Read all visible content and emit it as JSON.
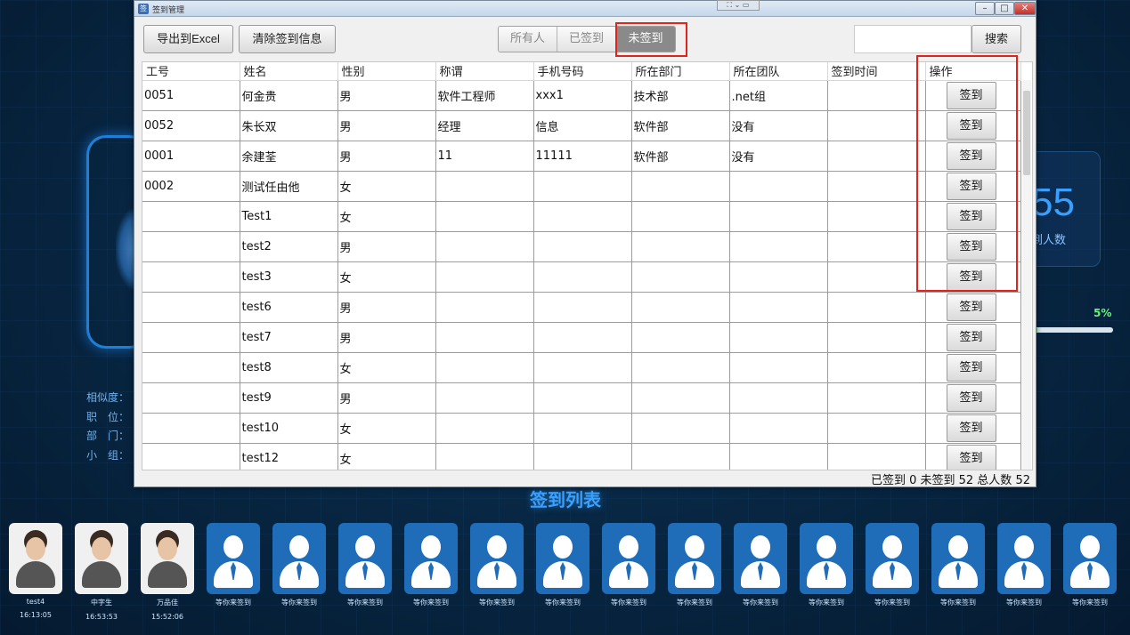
{
  "window": {
    "title": "签到管理",
    "float_bar": "⛶ ⌄ ▭"
  },
  "toolbar": {
    "export_label": "导出到Excel",
    "clear_label": "清除签到信息",
    "filters": [
      "所有人",
      "已签到",
      "未签到"
    ],
    "active_filter": "未签到",
    "search_value": "",
    "search_label": "搜索"
  },
  "table": {
    "columns": [
      "工号",
      "姓名",
      "性别",
      "称谓",
      "手机号码",
      "所在部门",
      "所在团队",
      "签到时间",
      "操作"
    ],
    "action_label": "签到",
    "rows": [
      [
        "0051",
        "何金贵",
        "男",
        "软件工程师",
        "xxx1",
        "技术部",
        ".net组",
        ""
      ],
      [
        "0052",
        "朱长双",
        "男",
        "经理",
        "信息",
        "软件部",
        "没有",
        ""
      ],
      [
        "0001",
        "余建荃",
        "男",
        "11",
        "11111",
        "软件部",
        "没有",
        ""
      ],
      [
        "0002",
        "测试任由他",
        "女",
        "",
        "",
        "",
        "",
        ""
      ],
      [
        "",
        "Test1",
        "女",
        "",
        "",
        "",
        "",
        ""
      ],
      [
        "",
        "test2",
        "男",
        "",
        "",
        "",
        "",
        ""
      ],
      [
        "",
        "test3",
        "女",
        "",
        "",
        "",
        "",
        ""
      ],
      [
        "",
        "test6",
        "男",
        "",
        "",
        "",
        "",
        ""
      ],
      [
        "",
        "test7",
        "男",
        "",
        "",
        "",
        "",
        ""
      ],
      [
        "",
        "test8",
        "女",
        "",
        "",
        "",
        "",
        ""
      ],
      [
        "",
        "test9",
        "男",
        "",
        "",
        "",
        "",
        ""
      ],
      [
        "",
        "test10",
        "女",
        "",
        "",
        "",
        "",
        ""
      ],
      [
        "",
        "test12",
        "女",
        "",
        "",
        "",
        "",
        ""
      ]
    ]
  },
  "status_bar": "已签到  0    未签到   52 总人数   52",
  "dashboard": {
    "info_labels": [
      "相似度：",
      "职　位：",
      "部　门：",
      "小　组："
    ],
    "stat_number": "55",
    "stat_label": "到人数",
    "percent": "5%",
    "percent_value": 0.05,
    "list_title": "签到列表"
  },
  "avatars": [
    {
      "name": "test4",
      "time": "16:13:05",
      "photo": true
    },
    {
      "name": "中字生",
      "time": "16:53:53",
      "photo": true
    },
    {
      "name": "万品佳",
      "time": "15:52:06",
      "photo": true
    },
    {
      "name": "等你来签到",
      "time": "",
      "photo": false
    },
    {
      "name": "等你来签到",
      "time": "",
      "photo": false
    },
    {
      "name": "等你来签到",
      "time": "",
      "photo": false
    },
    {
      "name": "等你来签到",
      "time": "",
      "photo": false
    },
    {
      "name": "等你来签到",
      "time": "",
      "photo": false
    },
    {
      "name": "等你来签到",
      "time": "",
      "photo": false
    },
    {
      "name": "等你来签到",
      "time": "",
      "photo": false
    },
    {
      "name": "等你来签到",
      "time": "",
      "photo": false
    },
    {
      "name": "等你来签到",
      "time": "",
      "photo": false
    },
    {
      "name": "等你来签到",
      "time": "",
      "photo": false
    },
    {
      "name": "等你来签到",
      "time": "",
      "photo": false
    },
    {
      "name": "等你来签到",
      "time": "",
      "photo": false
    },
    {
      "name": "等你来签到",
      "time": "",
      "photo": false
    },
    {
      "name": "等你来签到",
      "time": "",
      "photo": false
    }
  ],
  "colors": {
    "accent": "#3aa0ff",
    "highlight": "#e0241b",
    "progress": "#6cf080"
  }
}
